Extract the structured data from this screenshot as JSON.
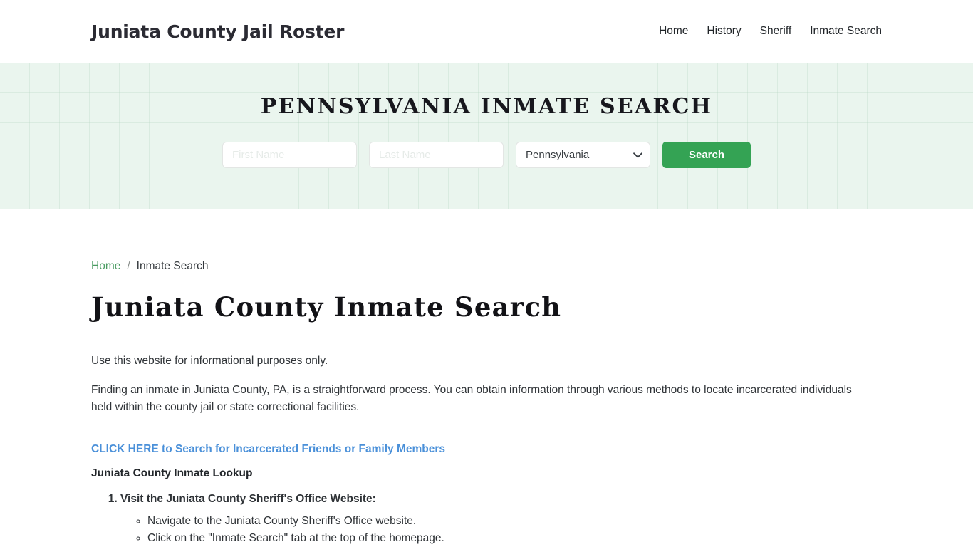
{
  "header": {
    "brand": "Juniata County Jail Roster",
    "nav": [
      {
        "label": "Home"
      },
      {
        "label": "History"
      },
      {
        "label": "Sheriff"
      },
      {
        "label": "Inmate Search"
      }
    ]
  },
  "hero": {
    "title": "Pennsylvania Inmate Search",
    "accent_green": "#34a354",
    "background": "#eaf5ee",
    "form": {
      "first_name_placeholder": "First Name",
      "first_name_value": "",
      "last_name_placeholder": "Last Name",
      "last_name_value": "",
      "state_selected": "Pennsylvania",
      "state_options": [
        "Pennsylvania"
      ],
      "chevron_icon": "chevron-down-icon",
      "search_label": "Search"
    }
  },
  "breadcrumb": {
    "home_label": "Home",
    "separator": "/",
    "current_label": "Inmate Search"
  },
  "main": {
    "page_title": "Juniata County Inmate Search",
    "intro": "Use this website for informational purposes only.",
    "paragraph": "Finding an inmate in Juniata County, PA, is a straightforward process. You can obtain information through various methods to locate incarcerated individuals held within the county jail or state correctional facilities.",
    "cta_link": "CLICK HERE to Search for Incarcerated Friends or Family Members",
    "cta_color": "#4a90d9",
    "sub_heading": "Juniata County Inmate Lookup",
    "steps": [
      {
        "label": "Visit the Juniata County Sheriff's Office Website:",
        "substeps": [
          "Navigate to the Juniata County Sheriff's Office website.",
          "Click on the \"Inmate Search\" tab at the top of the homepage."
        ]
      }
    ]
  }
}
